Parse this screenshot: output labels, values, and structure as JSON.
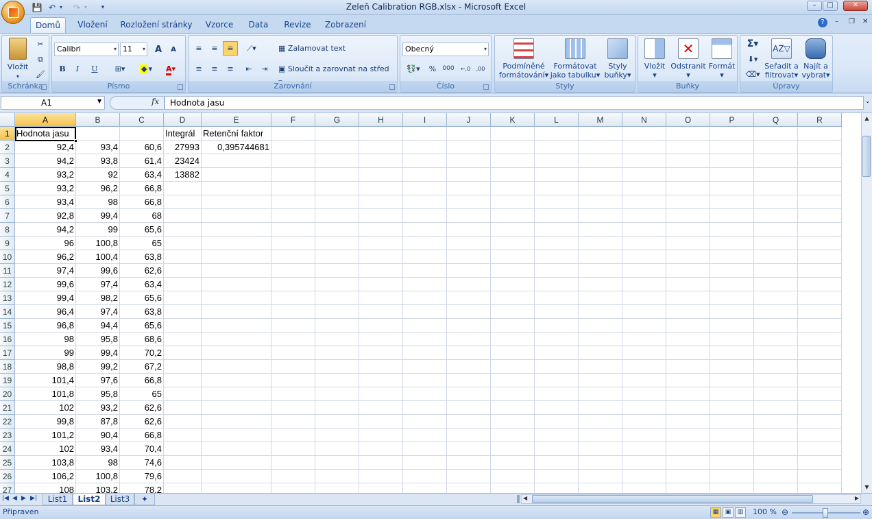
{
  "window": {
    "title": "Zeleň Calibration RGB.xlsx - Microsoft Excel",
    "minimize": "–",
    "maximize": "□",
    "close": "✕"
  },
  "tabs": [
    "Domů",
    "Vložení",
    "Rozložení stránky",
    "Vzorce",
    "Data",
    "Revize",
    "Zobrazení"
  ],
  "ribbon": {
    "clipboard": {
      "label": "Schránka",
      "paste": "Vložit"
    },
    "font": {
      "label": "Písmo",
      "name": "Calibri",
      "size": "11",
      "bold": "B",
      "italic": "I",
      "underline": "U",
      "grow": "A",
      "shrink": "A",
      "color_letter": "A"
    },
    "alignment": {
      "label": "Zarovnání",
      "wrap": "Zalamovat text",
      "merge": "Sloučit a zarovnat na střed"
    },
    "number": {
      "label": "Číslo",
      "format": "Obecný",
      "percent": "%",
      "thousands": "000",
      "inc_dec": "←,0\n,00",
      "dec_dec": ",00\n→,0"
    },
    "styles": {
      "label": "Styly",
      "conditional_1": "Podmíněné",
      "conditional_2": "formátování",
      "table_1": "Formátovat",
      "table_2": "jako tabulku",
      "cell_1": "Styly",
      "cell_2": "buňky"
    },
    "cells": {
      "label": "Buňky",
      "insert": "Vložit",
      "delete": "Odstranit",
      "format": "Formát"
    },
    "editing": {
      "label": "Úpravy",
      "sort_1": "Seřadit a",
      "sort_2": "filtrovat",
      "find_1": "Najít a",
      "find_2": "vybrat",
      "sum": "Σ"
    }
  },
  "formula_bar": {
    "name_box": "A1",
    "fx": "fx",
    "content": "Hodnota jasu"
  },
  "columns": [
    "A",
    "B",
    "C",
    "D",
    "E",
    "F",
    "G",
    "H",
    "I",
    "J",
    "K",
    "L",
    "M",
    "N",
    "O",
    "P",
    "Q",
    "R"
  ],
  "rows": [
    [
      "Hodnota jasu",
      "",
      "",
      "Integrál",
      "Retenční faktor"
    ],
    [
      "92,4",
      "93,4",
      "60,6",
      "27993",
      "0,395744681"
    ],
    [
      "94,2",
      "93,8",
      "61,4",
      "23424",
      ""
    ],
    [
      "93,2",
      "92",
      "63,4",
      "13882",
      ""
    ],
    [
      "93,2",
      "96,2",
      "66,8",
      "",
      ""
    ],
    [
      "93,4",
      "98",
      "66,8",
      "",
      ""
    ],
    [
      "92,8",
      "99,4",
      "68",
      "",
      ""
    ],
    [
      "94,2",
      "99",
      "65,6",
      "",
      ""
    ],
    [
      "96",
      "100,8",
      "65",
      "",
      ""
    ],
    [
      "96,2",
      "100,4",
      "63,8",
      "",
      ""
    ],
    [
      "97,4",
      "99,6",
      "62,6",
      "",
      ""
    ],
    [
      "99,6",
      "97,4",
      "63,4",
      "",
      ""
    ],
    [
      "99,4",
      "98,2",
      "65,6",
      "",
      ""
    ],
    [
      "96,4",
      "97,4",
      "63,8",
      "",
      ""
    ],
    [
      "96,8",
      "94,4",
      "65,6",
      "",
      ""
    ],
    [
      "98",
      "95,8",
      "68,6",
      "",
      ""
    ],
    [
      "99",
      "99,4",
      "70,2",
      "",
      ""
    ],
    [
      "98,8",
      "99,2",
      "67,2",
      "",
      ""
    ],
    [
      "101,4",
      "97,6",
      "66,8",
      "",
      ""
    ],
    [
      "101,8",
      "95,8",
      "65",
      "",
      ""
    ],
    [
      "102",
      "93,2",
      "62,6",
      "",
      ""
    ],
    [
      "99,8",
      "87,8",
      "62,6",
      "",
      ""
    ],
    [
      "101,2",
      "90,4",
      "66,8",
      "",
      ""
    ],
    [
      "102",
      "93,4",
      "70,4",
      "",
      ""
    ],
    [
      "103,8",
      "98",
      "74,6",
      "",
      ""
    ],
    [
      "106,2",
      "100,8",
      "79,6",
      "",
      ""
    ],
    [
      "108",
      "103,2",
      "78,2",
      "",
      ""
    ]
  ],
  "sheets": [
    "List1",
    "List2",
    "List3"
  ],
  "active_sheet": "List2",
  "status": {
    "text": "Připraven",
    "zoom": "100 %"
  }
}
